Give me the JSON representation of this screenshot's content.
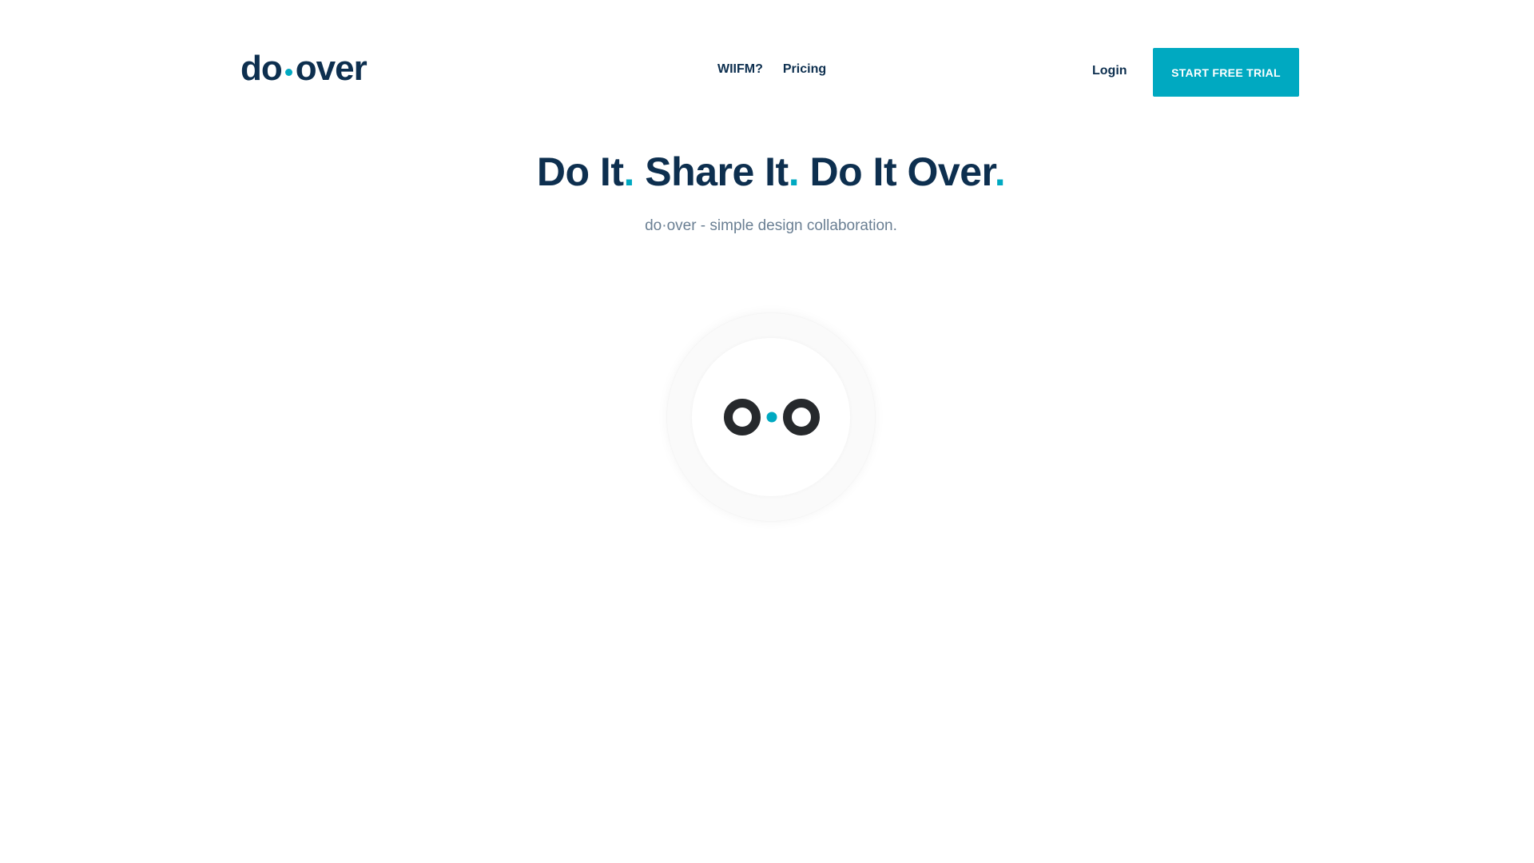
{
  "brand": {
    "logo_left": "do",
    "logo_right": "over",
    "accent_color": "#00a9c1",
    "text_color": "#0d2f4f"
  },
  "nav": {
    "items": [
      {
        "label": "WIIFM?"
      },
      {
        "label": "Pricing"
      }
    ],
    "login_label": "Login",
    "cta_label": "START FREE TRIAL"
  },
  "hero": {
    "headline_parts": [
      "Do It",
      "Share It",
      "Do It Over"
    ],
    "dot": ".",
    "subtitle": "do·over - simple design collaboration."
  },
  "loader": {
    "icon": "doover-logo-mark-icon"
  }
}
